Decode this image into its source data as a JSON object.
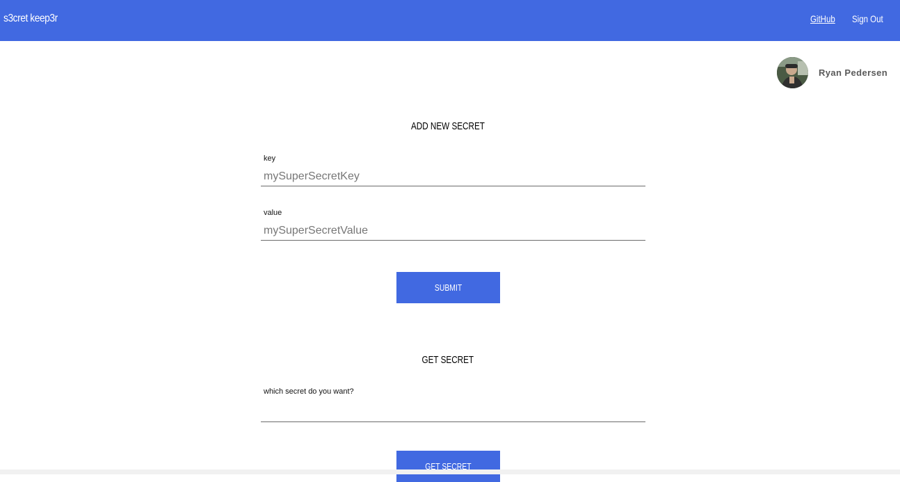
{
  "navbar": {
    "brand": "s3cret keep3r",
    "links": {
      "github": "GitHub",
      "sign_out": "Sign Out"
    },
    "color": "#4169e1"
  },
  "user": {
    "name": "Ryan Pedersen",
    "avatar_icon": "user-photo-avatar"
  },
  "add_secret": {
    "title": "ADD NEW SECRET",
    "key_label": "key",
    "key_placeholder": "mySuperSecretKey",
    "key_value": "",
    "value_label": "value",
    "value_placeholder": "mySuperSecretValue",
    "value_value": "",
    "submit_label": "SUBMIT"
  },
  "get_secret": {
    "title": "GET SECRET",
    "query_label": "which secret do you want?",
    "query_placeholder": "",
    "query_value": "",
    "button_label": "GET SECRET"
  }
}
